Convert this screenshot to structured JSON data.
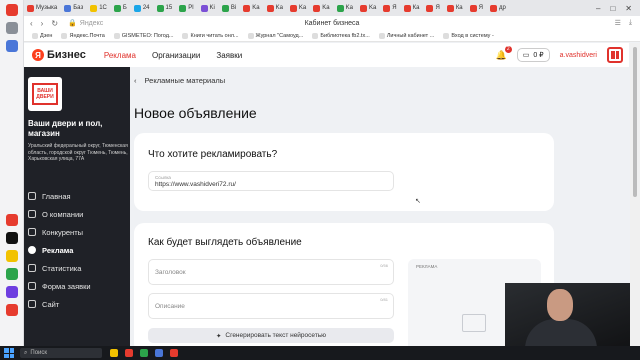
{
  "browser": {
    "tabs": [
      {
        "label": "Музыка",
        "color": "#e63b2e"
      },
      {
        "label": "Баз",
        "color": "#4a76d8"
      },
      {
        "label": "1С",
        "color": "#f2c200"
      },
      {
        "label": "Б",
        "color": "#2ca44b"
      },
      {
        "label": "24",
        "color": "#1aa6e8"
      },
      {
        "label": "15",
        "color": "#2ca44b"
      },
      {
        "label": "Pl",
        "color": "#2ca44b"
      },
      {
        "label": "Ki",
        "color": "#7b4fd6"
      },
      {
        "label": "Ві",
        "color": "#2ca44b"
      },
      {
        "label": "Ka",
        "color": "#e63b2e"
      },
      {
        "label": "Ka",
        "color": "#e63b2e"
      },
      {
        "label": "Ka",
        "color": "#e63b2e"
      },
      {
        "label": "Ka",
        "color": "#e63b2e"
      },
      {
        "label": "Ka",
        "color": "#2ca44b"
      },
      {
        "label": "Ka",
        "color": "#e63b2e"
      },
      {
        "label": "Я",
        "color": "#e63b2e"
      },
      {
        "label": "Ка",
        "color": "#e63b2e"
      },
      {
        "label": "Я",
        "color": "#e63b2e"
      },
      {
        "label": "Ка",
        "color": "#e63b2e"
      },
      {
        "label": "Я",
        "color": "#e63b2e"
      },
      {
        "label": "др",
        "color": "#e63b2e"
      }
    ],
    "url": "Яндекс",
    "page_title": "Кабинет бизнеса",
    "bookmarks": [
      "Дзен",
      "Яндекс.Почта",
      "GISMETEO: Погод...",
      "Книги читать онл...",
      "Журнал \"Самоуд...",
      "Библиотека fb2.tx...",
      "Личный кабинет ...",
      "Вход в систему -"
    ]
  },
  "header": {
    "logo": "Бизнес",
    "logo_mark": "Я",
    "nav": [
      "Реклама",
      "Организации",
      "Заявки"
    ],
    "notifications": "2",
    "balance": "0 ₽",
    "user": "a.vashidveri"
  },
  "sidebar": {
    "logo_text": "ВАШИ ДВЕРИ",
    "company_name": "Ваши двери и пол, магазин",
    "company_address": "Уральский федеральный округ, Тюменская область, городской округ Тюмень, Тюмень, Харьковская улица, 77А",
    "items": [
      {
        "label": "Главная",
        "active": false
      },
      {
        "label": "О компании",
        "active": false
      },
      {
        "label": "Конкуренты",
        "active": false
      },
      {
        "label": "Реклама",
        "active": true
      },
      {
        "label": "Статистика",
        "active": false
      },
      {
        "label": "Форма заявки",
        "active": false
      },
      {
        "label": "Сайт",
        "active": false
      }
    ]
  },
  "main": {
    "breadcrumb": "Рекламные материалы",
    "title": "Новое объявление",
    "section1": {
      "title": "Что хотите рекламировать?",
      "link_label": "Ссылка",
      "link_value": "https://www.vashidveri72.ru/"
    },
    "section2": {
      "title": "Как будет выглядеть объявление",
      "headline_placeholder": "Заголовок",
      "headline_counter": "0/56",
      "description_placeholder": "Описание",
      "description_counter": "0/81",
      "generate_button": "Сгенерировать текст нейросетью",
      "preview_label": "РЕКЛАМА"
    }
  },
  "taskbar": {
    "search_placeholder": "Поиск"
  }
}
